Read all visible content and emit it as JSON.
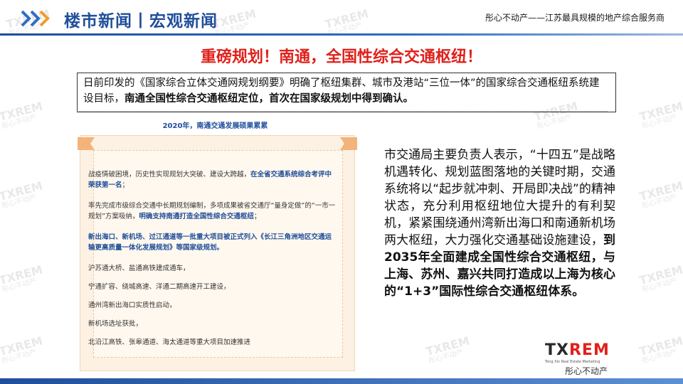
{
  "header": {
    "section_title": "楼市新闻丨宏观新闻",
    "tagline": "彤心不动产——江苏最具规模的地产综合服务商"
  },
  "headline": "重磅规划！南通，全国性综合交通枢纽！",
  "intro": {
    "normal": "日前印发的《国家综合立体交通网规划纲要》明确了枢纽集群、城市及港站“三位一体”的国家综合交通枢纽系统建设目标，",
    "bold": "南通全国性综合交通枢纽定位，首次在国家级规划中得到确认。"
  },
  "panel": {
    "title": "2020年，南通交通发展硕果累累",
    "items": [
      {
        "normal": "战疫情破困境，历史性实现规划大突破、建设大跨越，",
        "emphasis": "在全省交通系统综合考评中荣获第一名",
        "tail": "；"
      },
      {
        "normal": "率先完成市级综合交通中长期规划编制，多项成果被省交通厅“量身定做”的“一市一规划”方案吸纳，",
        "emphasis": "明确支持南通打造全国性综合交通枢纽",
        "tail": "；"
      },
      {
        "strong": "新出海口、新机场、过江通道等一批重大项目被正式列入《长江三角洲地区交通运输更高质量一体化发展规划》等国家级规划。"
      },
      {
        "normal": "沪苏通大桥、盐通高铁建成通车，"
      },
      {
        "normal": "宁通扩容、绕城高速、洋通二期高速开工建设，"
      },
      {
        "normal": "通州湾新出海口实质性启动，"
      },
      {
        "normal": "新机场选址获批，"
      },
      {
        "normal": "北沿江高铁、张皋通道、海太通道等重大项目加速推进"
      }
    ]
  },
  "body": {
    "normal": "市交通局主要负责人表示，“十四五”是战略机遇转化、规划蓝图落地的关键时期，交通系统将以“起步就冲刺、开局即决战”的精神状态，充分利用枢纽地位大提升的有利契机，紧紧围绕通州湾新出海口和南通新机场两大枢纽，大力强化交通基础设施建设，",
    "bold": "到2035年全面建成全国性综合交通枢纽，与上海、苏州、嘉兴共同打造成以上海为核心的“1+3”国际性综合交通枢纽体系。"
  },
  "logo": {
    "main_a": "TX",
    "main_b": "REM",
    "sub": "Tong Xin Real Estate Marketing",
    "cn": "彤心不动产"
  },
  "watermark": {
    "en": "TXREM",
    "cn": "彤心不动产"
  },
  "colors": {
    "brand_blue": "#1f4e9a",
    "headline_red": "#e0201b",
    "chevron_blue": "#2e6dc2",
    "chevron_orange": "#f29a2e"
  }
}
